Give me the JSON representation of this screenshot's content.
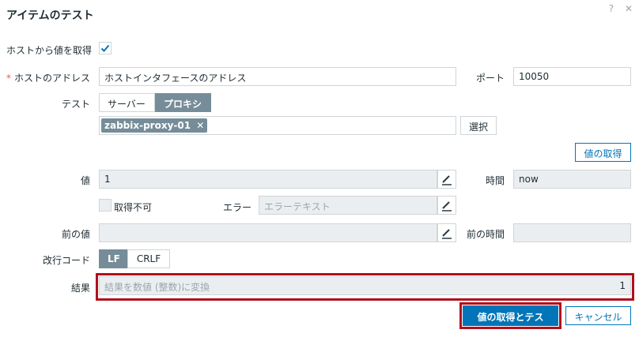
{
  "dialog": {
    "title": "アイテムのテスト",
    "help_glyph": "?",
    "close_glyph": "✕"
  },
  "get_from_host": {
    "label": "ホストから値を取得",
    "checked": true
  },
  "host_address": {
    "label": "ホストのアドレス",
    "required_mark": "*",
    "value": "ホストインタフェースのアドレス"
  },
  "port": {
    "label": "ポート",
    "value": "10050"
  },
  "test": {
    "label": "テスト",
    "options": [
      "サーバー",
      "プロキシ"
    ],
    "selected": "プロキシ",
    "proxy_tag": "zabbix-proxy-01",
    "tag_remove_glyph": "✕",
    "select_button": "選択"
  },
  "get_value_button": "値の取得",
  "value": {
    "label": "値",
    "value": "1"
  },
  "time": {
    "label": "時間",
    "value": "now"
  },
  "not_supported": {
    "label": "取得不可"
  },
  "error": {
    "label": "エラー",
    "placeholder": "エラーテキスト"
  },
  "prev_value": {
    "label": "前の値",
    "value": ""
  },
  "prev_time": {
    "label": "前の時間",
    "value": ""
  },
  "eol": {
    "label": "改行コード",
    "options": [
      "LF",
      "CRLF"
    ],
    "selected": "LF"
  },
  "result": {
    "label": "結果",
    "placeholder": "結果を数値 (整数)に変換",
    "value": "1"
  },
  "footer": {
    "primary_button": "値の取得とテスト",
    "cancel_button": "キャンセル"
  },
  "colors": {
    "accent": "#0275b8",
    "highlight": "#b0101c",
    "segment_on": "#768d99"
  },
  "icons": {
    "checkmark": "checkmark-icon",
    "edit": "pencil-icon"
  }
}
